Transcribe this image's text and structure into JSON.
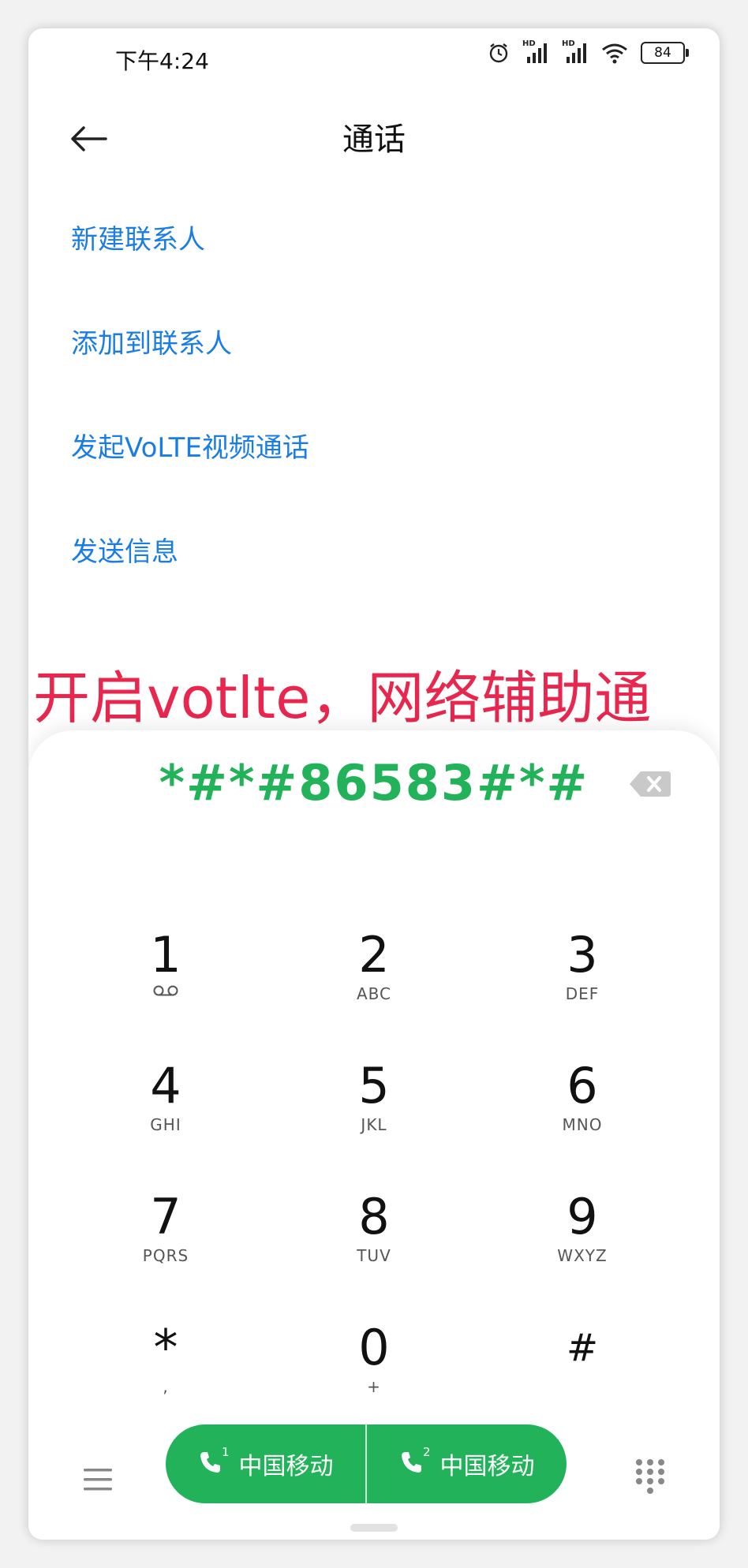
{
  "status_bar": {
    "time": "下午4:24",
    "hd1": "HD",
    "hd2": "HD",
    "battery": "84"
  },
  "header": {
    "title": "通话",
    "back_icon": "arrow-left-icon"
  },
  "menu": {
    "items": [
      {
        "label": "新建联系人"
      },
      {
        "label": "添加到联系人"
      },
      {
        "label": "发起VoLTE视频通话"
      },
      {
        "label": "发送信息"
      }
    ]
  },
  "overlay": {
    "caption": "开启votlte，网络辅助通"
  },
  "dialer": {
    "number": "*#*#86583#*#",
    "keys": [
      {
        "digit": "1",
        "letters": ""
      },
      {
        "digit": "2",
        "letters": "ABC"
      },
      {
        "digit": "3",
        "letters": "DEF"
      },
      {
        "digit": "4",
        "letters": "GHI"
      },
      {
        "digit": "5",
        "letters": "JKL"
      },
      {
        "digit": "6",
        "letters": "MNO"
      },
      {
        "digit": "7",
        "letters": "PQRS"
      },
      {
        "digit": "8",
        "letters": "TUV"
      },
      {
        "digit": "9",
        "letters": "WXYZ"
      },
      {
        "digit": "*",
        "letters": ","
      },
      {
        "digit": "0",
        "letters": "+"
      },
      {
        "digit": "#",
        "letters": ""
      }
    ]
  },
  "call_bar": {
    "sim1": {
      "label": "中国移动",
      "slot": "1"
    },
    "sim2": {
      "label": "中国移动",
      "slot": "2"
    }
  },
  "colors": {
    "accent_blue": "#1a7de3",
    "call_green": "#22b35a",
    "caption_red": "#e8264e"
  }
}
